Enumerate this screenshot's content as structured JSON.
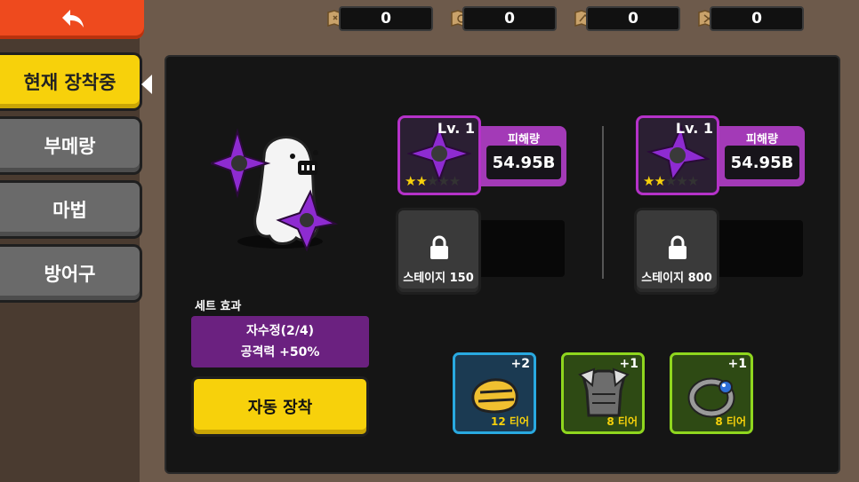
{
  "sidebar": {
    "back_icon": "back-arrow-icon",
    "tabs": [
      {
        "label": "현재 장착중",
        "active": true
      },
      {
        "label": "부메랑",
        "active": false
      },
      {
        "label": "마법",
        "active": false
      },
      {
        "label": "방어구",
        "active": false
      }
    ]
  },
  "resources": [
    {
      "icon": "map-scroll-icon",
      "value": "0"
    },
    {
      "icon": "ring-scroll-icon",
      "value": "0"
    },
    {
      "icon": "map-scroll-icon",
      "value": "0"
    },
    {
      "icon": "map-scroll-icon",
      "value": "0"
    }
  ],
  "equipped": [
    {
      "level": "Lv. 1",
      "damage_label": "피해량",
      "damage_value": "54.95B",
      "stars": 2,
      "max_stars": 5
    },
    {
      "level": "Lv. 1",
      "damage_label": "피해량",
      "damage_value": "54.95B",
      "stars": 2,
      "max_stars": 5
    }
  ],
  "locked_slots": [
    {
      "label": "스테이지 150"
    },
    {
      "label": "스테이지 800"
    }
  ],
  "set_effect": {
    "title": "세트 효과",
    "name": "자수정(2/4)",
    "bonus": "공격력 +50%"
  },
  "auto_equip_label": "자동 장착",
  "items": [
    {
      "plus": "+2",
      "tier": "12 티어",
      "border": "#29a9e0",
      "bg": "#1b3a52",
      "icon": "gauntlet-icon"
    },
    {
      "plus": "+1",
      "tier": "8 티어",
      "border": "#8fd61e",
      "bg": "#2e4a14",
      "icon": "armor-icon"
    },
    {
      "plus": "+1",
      "tier": "8 티어",
      "border": "#8fd61e",
      "bg": "#2e4a14",
      "icon": "ring-icon"
    }
  ],
  "colors": {
    "accent_yellow": "#f7d10b",
    "back_orange": "#ee4a1e",
    "epic_purple": "#b532c9"
  }
}
